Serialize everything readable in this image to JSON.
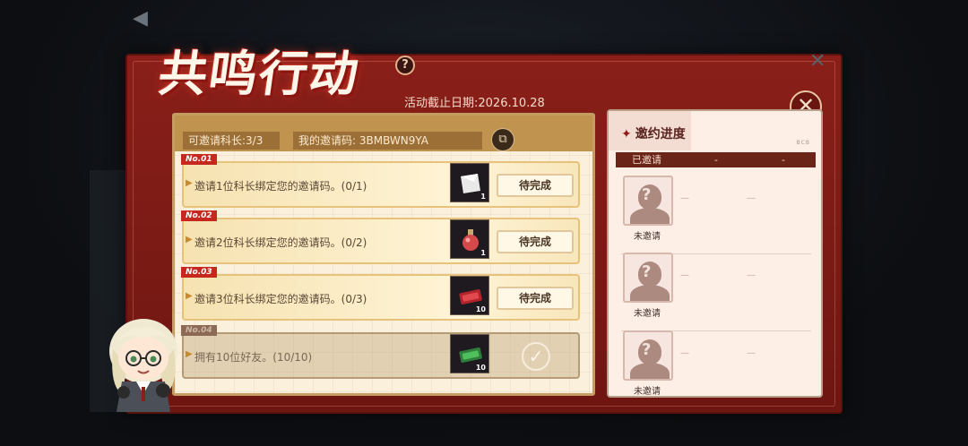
{
  "event": {
    "title": "共鸣行动",
    "help_icon": "?",
    "deadline": "活动截止日期:2026.10.28",
    "close_icon": "close-icon"
  },
  "header": {
    "invites_remaining": "可邀请科长:3/3",
    "my_code": "我的邀请码: 3BMBWN9YA",
    "copy_icon": "copy-icon"
  },
  "tasks": [
    {
      "no": "No.01",
      "desc": "邀请1位科长绑定您的邀请码。(0/1)",
      "reward_qty": "1",
      "reward": "white-card",
      "status": "待完成"
    },
    {
      "no": "No.02",
      "desc": "邀请2位科长绑定您的邀请码。(0/2)",
      "reward_qty": "1",
      "reward": "red-potion",
      "status": "待完成"
    },
    {
      "no": "No.03",
      "desc": "邀请3位科长绑定您的邀请码。(0/3)",
      "reward_qty": "10",
      "reward": "red-ticket",
      "status": "待完成"
    },
    {
      "no": "No.04",
      "desc": "拥有10位好友。(10/10)",
      "reward_qty": "10",
      "reward": "green-ticket",
      "status": ""
    }
  ],
  "progress": {
    "title": "邀约进度",
    "brand": "BCB",
    "invited_label": "已邀请",
    "col1": "-",
    "col2": "-",
    "slots": [
      {
        "label": "未邀请",
        "d1": "—",
        "d2": "—"
      },
      {
        "label": "未邀请",
        "d1": "—",
        "d2": "—"
      },
      {
        "label": "未邀请",
        "d1": "—",
        "d2": "—"
      }
    ]
  },
  "colors": {
    "panel": "#8a1f19",
    "accent": "#c6281d",
    "card": "#fbf0dc"
  }
}
